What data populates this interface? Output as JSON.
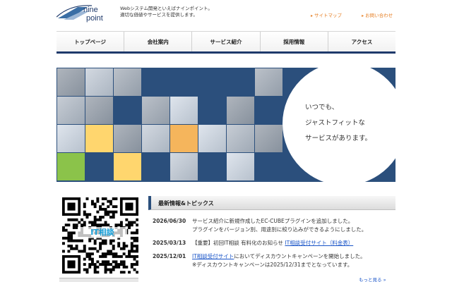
{
  "header": {
    "logo_text": "nine point",
    "tagline_line1": "Webシステム開発といえばナインポイント。",
    "tagline_line2": "適切な価値やサービスを提供します。",
    "links": [
      "サイトマップ",
      "お問い合わせ"
    ]
  },
  "nav": {
    "items": [
      "トップページ",
      "会社案内",
      "サービス紹介",
      "採用情報",
      "アクセス"
    ]
  },
  "hero": {
    "slogan_line1": "いつでも、",
    "slogan_line2": "ジャストフィットな",
    "slogan_line3": "サービスがあります。",
    "colors": {
      "navy": "#2b4f7c",
      "gray": "#b9c3d1",
      "yellow": "#ffd66e",
      "orange": "#f5b55c",
      "green": "#8bc34a"
    }
  },
  "qr": {
    "label": "IT相談"
  },
  "news": {
    "heading": "最新情報&トピックス",
    "items": [
      {
        "date": "2026/06/30",
        "line1": "サービス紹介に新規作成したEC-CUBEプラグインを追加しました。",
        "line2": "プラグインをバージョン別、用途別に絞り込みができるようにしました。"
      },
      {
        "date": "2025/03/13",
        "pre": "【重要】初回IT相談 有料化のお知らせ",
        "link": "IT相談受付サイト（料金表）"
      },
      {
        "date": "2025/12/01",
        "link": "IT相談受付サイト",
        "post": "においてディスカウントキャンペーンを開始しました。",
        "line2": "※ディスカウントキャンペーンは2025/12/31までとなっています。"
      }
    ],
    "more_label": "もっと見る"
  }
}
